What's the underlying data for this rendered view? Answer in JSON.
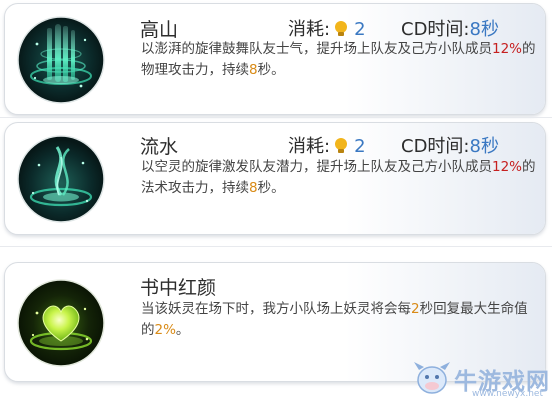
{
  "skills": [
    {
      "name": "高山",
      "cost_label": "消耗:",
      "cost_value": "2",
      "cd_label": "CD时间:",
      "cd_value": "8秒",
      "desc_a": "以澎湃的旋律鼓舞队友士气，提升场上队友及己方小队成员",
      "desc_b": "12%",
      "desc_c": "的物理攻击力，持续",
      "desc_d": "8",
      "desc_e": "秒。",
      "icon": "green-fountain-icon"
    },
    {
      "name": "流水",
      "cost_label": "消耗:",
      "cost_value": "2",
      "cd_label": "CD时间:",
      "cd_value": "8秒",
      "desc_a": "以空灵的旋律激发队友潜力，提升场上队友及己方小队成员",
      "desc_b": "12%",
      "desc_c": "的法术攻击力，持续",
      "desc_d": "8",
      "desc_e": "秒。",
      "icon": "green-swirl-icon"
    },
    {
      "name": "书中红颜",
      "desc_a": "当该妖灵在场下时，我方小队场上妖灵将会每",
      "desc_b": "2",
      "desc_c": "秒回复最大生命值的",
      "desc_d": "2%",
      "desc_e": "。",
      "icon": "green-heart-icon"
    }
  ],
  "watermark": {
    "text": "牛游戏网",
    "url": "www.newyx.net"
  },
  "colors": {
    "value_blue": "#3a78c2",
    "highlight_red": "#c62020",
    "highlight_orange": "#d98b17",
    "bulb_yellow": "#f2b51c"
  }
}
